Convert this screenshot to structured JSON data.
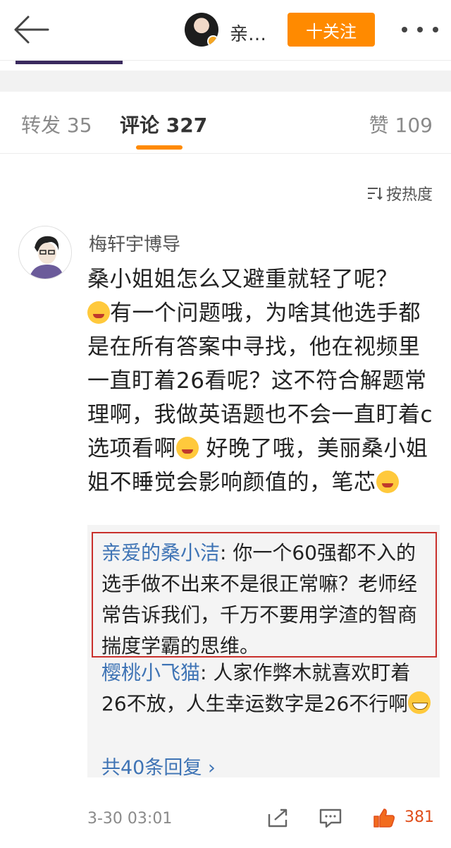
{
  "header": {
    "title": "亲…",
    "follow_label": "十关注"
  },
  "tabs": {
    "repost": "转发 35",
    "comment": "评论 327",
    "like": "赞 109"
  },
  "sort": {
    "label": "按热度",
    "icon": "sort-icon"
  },
  "comment": {
    "author": "梅轩宇博导",
    "text_line1": "桑小姐姐怎么又避重就轻了呢？",
    "text_part2": "有一个问题哦，为啥其他选手都是在所有答案中寻找，他在视频里一直盯着26看呢？这不符合解题常理啊，我做英语题也不会一直盯着c选项看啊",
    "text_part3": " 好晚了哦，美丽桑小姐姐不睡觉会影响颜值的，笔芯",
    "time": "3-30 03:01",
    "likes": "381"
  },
  "replies": [
    {
      "user": "亲爱的桑小洁",
      "text": ": 你一个60强都不入的选手做不出来不是很正常嘛？老师经常告诉我们，千万不要用学渣的智商揣度学霸的思维。"
    },
    {
      "user": "樱桃小飞猫",
      "text": ": 人家作弊木就喜欢盯着26不放，人生幸运数字是26不行啊"
    }
  ],
  "more_replies": "共40条回复 ›",
  "colors": {
    "accent": "#ff8a00",
    "link": "#3f74b5",
    "highlight_border": "#c9302c"
  }
}
